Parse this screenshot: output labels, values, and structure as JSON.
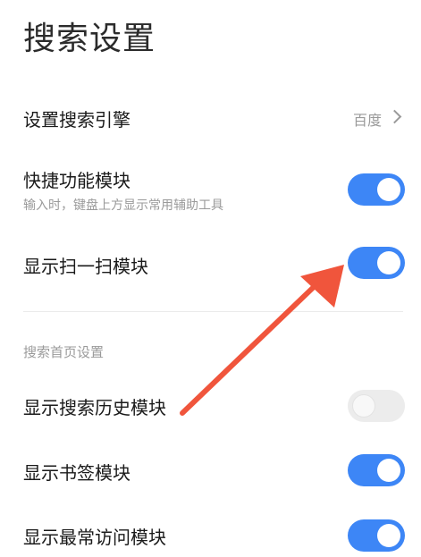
{
  "header": {
    "title": "搜索设置"
  },
  "settings": {
    "engine": {
      "label": "设置搜索引擎",
      "value": "百度",
      "icon": "chevron-right-icon"
    },
    "shortcut": {
      "label": "快捷功能模块",
      "description": "输入时，键盘上方显示常用辅助工具",
      "enabled": true
    },
    "scan": {
      "label": "显示扫一扫模块",
      "enabled": true
    }
  },
  "home_section": {
    "header": "搜索首页设置",
    "items": [
      {
        "label": "显示搜索历史模块",
        "enabled": false
      },
      {
        "label": "显示书签模块",
        "enabled": true
      },
      {
        "label": "显示最常访问模块",
        "enabled": true
      }
    ]
  },
  "colors": {
    "toggle_on": "#3d86f6",
    "toggle_off": "#ececec",
    "annotation_arrow": "#f0553c"
  },
  "annotation": {
    "icon": "red-arrow-annotation"
  }
}
